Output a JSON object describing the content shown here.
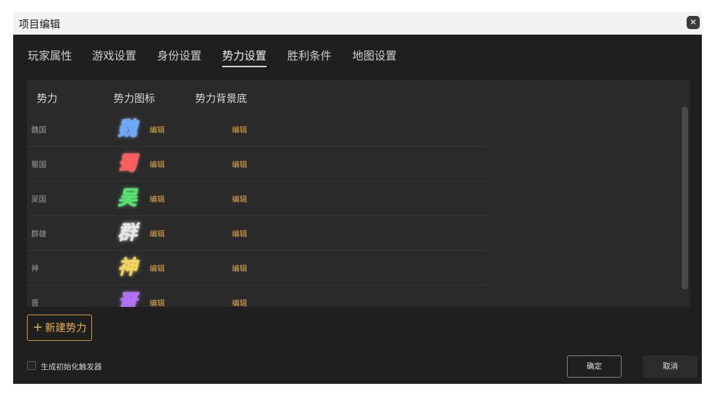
{
  "window": {
    "title": "项目编辑",
    "close_icon": "close-icon"
  },
  "tabs": [
    {
      "label": "玩家属性",
      "active": false
    },
    {
      "label": "游戏设置",
      "active": false
    },
    {
      "label": "身份设置",
      "active": false
    },
    {
      "label": "势力设置",
      "active": true
    },
    {
      "label": "胜利条件",
      "active": false
    },
    {
      "label": "地图设置",
      "active": false
    }
  ],
  "table": {
    "headers": [
      "势力",
      "势力图标",
      "势力背景底"
    ],
    "rows": [
      {
        "name": "魏国",
        "emblem": "魏",
        "emblem_color": "#6aa8ff",
        "edit_icon_label": "编辑",
        "edit_bg_label": "编辑"
      },
      {
        "name": "蜀国",
        "emblem": "蜀",
        "emblem_color": "#ff5a5a",
        "edit_icon_label": "编辑",
        "edit_bg_label": "编辑"
      },
      {
        "name": "吴国",
        "emblem": "吴",
        "emblem_color": "#4fe86a",
        "edit_icon_label": "编辑",
        "edit_bg_label": "编辑"
      },
      {
        "name": "群雄",
        "emblem": "群",
        "emblem_color": "#e6e6e6",
        "edit_icon_label": "编辑",
        "edit_bg_label": "编辑"
      },
      {
        "name": "神",
        "emblem": "神",
        "emblem_color": "#f3d75a",
        "edit_icon_label": "编辑",
        "edit_bg_label": "编辑"
      },
      {
        "name": "晋",
        "emblem": "晋",
        "emblem_color": "#b56bff",
        "edit_icon_label": "编辑",
        "edit_bg_label": "编辑"
      }
    ]
  },
  "actions": {
    "new_faction_plus": "+",
    "new_faction_label": "新建势力",
    "checkbox_label": "生成初始化触发器",
    "checkbox_checked": false,
    "ok_label": "确定",
    "cancel_label": "取消"
  },
  "colors": {
    "accent": "#e2a94a",
    "background": "#1f1f1f",
    "panel": "#2a2a2a"
  }
}
